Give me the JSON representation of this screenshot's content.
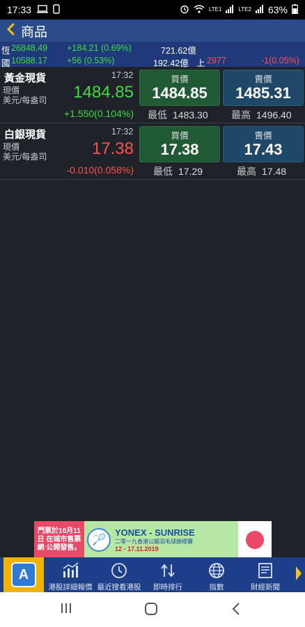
{
  "status_bar": {
    "time": "17:33",
    "battery": "63%",
    "net1": "LTE1",
    "net2": "LTE2"
  },
  "header": {
    "title": "商品"
  },
  "ticker": {
    "row1": {
      "label": "恆",
      "value": "26848.49",
      "change": "+184.21 (0.69%)",
      "turnover": "721.62億"
    },
    "row2": {
      "label": "國",
      "value": "10588.17",
      "change": "+56 (0.53%)",
      "turnover": "192.42億",
      "extra_label": "上",
      "extra_value": "2977",
      "extra_change": "-1(0.05%)"
    }
  },
  "commodities": [
    {
      "name": "黃金現貨",
      "time": "17:32",
      "sub1": "現價",
      "sub2": "美元/每盎司",
      "price": "1484.85",
      "change": "+1.550(0.104%)",
      "buy_label": "買價",
      "buy_value": "1484.85",
      "sell_label": "賣價",
      "sell_value": "1485.31",
      "low_label": "最低",
      "low_value": "1483.30",
      "high_label": "最高",
      "high_value": "1496.40"
    },
    {
      "name": "白銀現貨",
      "time": "17:32",
      "sub1": "現價",
      "sub2": "美元/每盎司",
      "price": "17.38",
      "change": "-0.010(0.058%)",
      "buy_label": "買價",
      "buy_value": "17.38",
      "sell_label": "賣價",
      "sell_value": "17.43",
      "low_label": "最低",
      "low_value": "17.29",
      "high_label": "最高",
      "high_value": "17.48"
    }
  ],
  "ad": {
    "left_text": "門票於10月11日 在城市售票網 公開發售。",
    "title": "YONEX - SUNRISE",
    "subtitle": "二零一九香港公開羽毛球錦標賽",
    "date": "12 - 17.11.2019"
  },
  "bottom_nav": [
    {
      "label": "港股詳細報價",
      "icon": "chart-icon"
    },
    {
      "label": "最近搜看港股",
      "icon": "clock-icon"
    },
    {
      "label": "即時排行",
      "icon": "ranking-icon"
    },
    {
      "label": "指數",
      "icon": "globe-icon"
    },
    {
      "label": "財經新聞",
      "icon": "news-icon"
    }
  ],
  "colors": {
    "up": "#3fdc3f",
    "down": "#ff5050",
    "header": "#2a4a8a",
    "nav": "#1d3f8a"
  }
}
